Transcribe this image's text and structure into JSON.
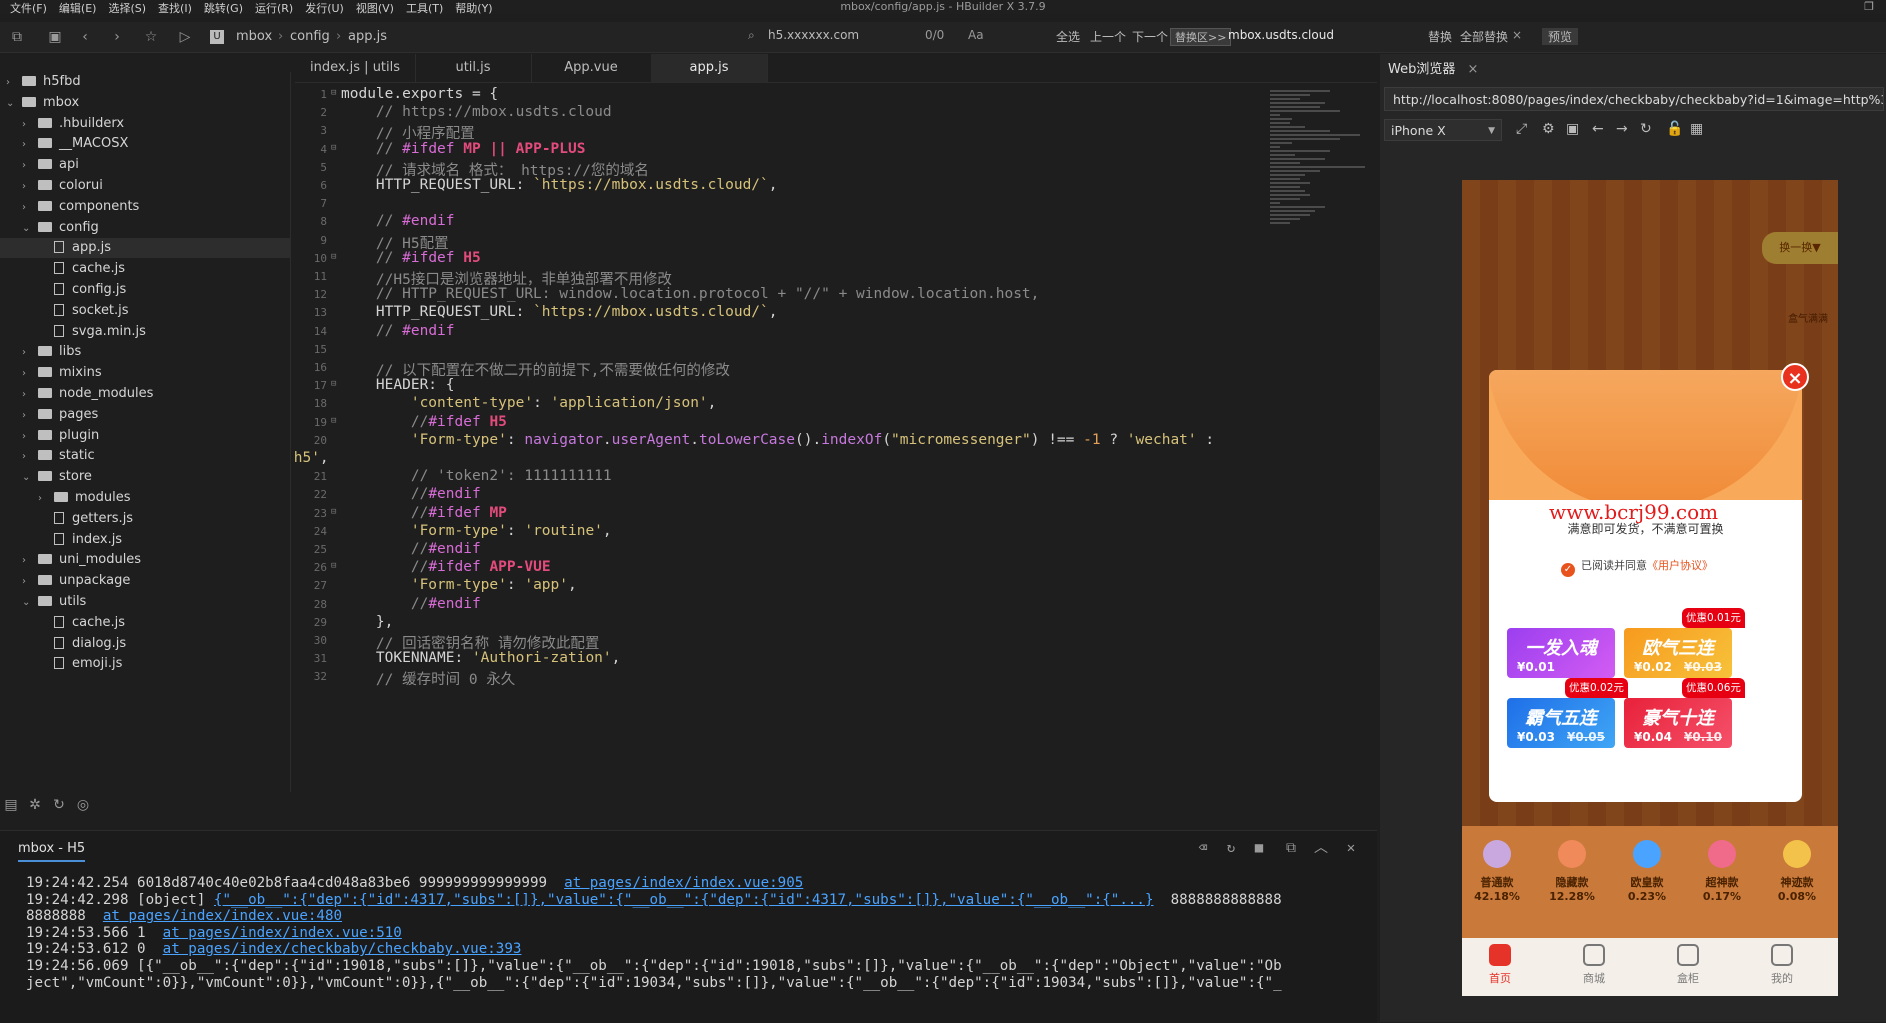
{
  "menubar": {
    "items": [
      "文件(F)",
      "编辑(E)",
      "选择(S)",
      "查找(I)",
      "跳转(G)",
      "运行(R)",
      "发行(U)",
      "视图(V)",
      "工具(T)",
      "帮助(Y)"
    ],
    "title": "mbox/config/app.js - HBuilder X 3.7.9"
  },
  "toolbar": {
    "breadcrumb": [
      "mbox",
      "config",
      "app.js"
    ],
    "find_value": "h5.xxxxxx.com",
    "find_count": "0/0",
    "case_label": "Aa",
    "select_all": "全选",
    "prev": "上一个",
    "next": "下一个",
    "replace_toggle": "替换区>>",
    "replace_value": "mbox.usdts.cloud",
    "replace": "替换",
    "replace_all": "全部替换",
    "preview": "预览"
  },
  "tree": [
    {
      "label": "h5fbd",
      "type": "folder",
      "level": 0,
      "open": false
    },
    {
      "label": "mbox",
      "type": "folder",
      "level": 0,
      "open": true
    },
    {
      "label": ".hbuilderx",
      "type": "folder",
      "level": 1,
      "open": false
    },
    {
      "label": "__MACOSX",
      "type": "folder",
      "level": 1,
      "open": false
    },
    {
      "label": "api",
      "type": "folder",
      "level": 1,
      "open": false
    },
    {
      "label": "colorui",
      "type": "folder",
      "level": 1,
      "open": false
    },
    {
      "label": "components",
      "type": "folder",
      "level": 1,
      "open": false
    },
    {
      "label": "config",
      "type": "folder",
      "level": 1,
      "open": true
    },
    {
      "label": "app.js",
      "type": "file",
      "level": 2,
      "selected": true
    },
    {
      "label": "cache.js",
      "type": "file",
      "level": 2
    },
    {
      "label": "config.js",
      "type": "file",
      "level": 2
    },
    {
      "label": "socket.js",
      "type": "file",
      "level": 2
    },
    {
      "label": "svga.min.js",
      "type": "file",
      "level": 2
    },
    {
      "label": "libs",
      "type": "folder",
      "level": 1,
      "open": false
    },
    {
      "label": "mixins",
      "type": "folder",
      "level": 1,
      "open": false
    },
    {
      "label": "node_modules",
      "type": "folder",
      "level": 1,
      "open": false
    },
    {
      "label": "pages",
      "type": "folder",
      "level": 1,
      "open": false
    },
    {
      "label": "plugin",
      "type": "folder",
      "level": 1,
      "open": false
    },
    {
      "label": "static",
      "type": "folder",
      "level": 1,
      "open": false
    },
    {
      "label": "store",
      "type": "folder",
      "level": 1,
      "open": true
    },
    {
      "label": "modules",
      "type": "folder",
      "level": 2,
      "open": false
    },
    {
      "label": "getters.js",
      "type": "file",
      "level": 2
    },
    {
      "label": "index.js",
      "type": "file",
      "level": 2
    },
    {
      "label": "uni_modules",
      "type": "folder",
      "level": 1,
      "open": false
    },
    {
      "label": "unpackage",
      "type": "folder",
      "level": 1,
      "open": false
    },
    {
      "label": "utils",
      "type": "folder",
      "level": 1,
      "open": true
    },
    {
      "label": "cache.js",
      "type": "file",
      "level": 2
    },
    {
      "label": "dialog.js",
      "type": "file",
      "level": 2
    },
    {
      "label": "emoji.js",
      "type": "file",
      "level": 2
    }
  ],
  "tabs": [
    {
      "label": "index.js | utils",
      "active": false
    },
    {
      "label": "util.js",
      "active": false
    },
    {
      "label": "App.vue",
      "active": false
    },
    {
      "label": "app.js",
      "active": true
    }
  ],
  "code": [
    {
      "n": 1,
      "fold": true,
      "html": "module.exports = {"
    },
    {
      "n": 2,
      "html": "    <span class='cmt'>// https://mbox.usdts.cloud</span>"
    },
    {
      "n": 3,
      "html": "    <span class='cmt'>// 小程序配置</span>"
    },
    {
      "n": 4,
      "fold": true,
      "html": "    <span class='cmt'>// </span><span class='kw'>#ifdef</span> <span class='kw2'>MP || APP-PLUS</span>"
    },
    {
      "n": 5,
      "html": "    <span class='cmt'>// 请求域名 格式： https://您的域名</span>"
    },
    {
      "n": 6,
      "html": "    HTTP_REQUEST_URL: <span class='str'>`https://mbox.usdts.cloud/`</span>,"
    },
    {
      "n": 7,
      "html": ""
    },
    {
      "n": 8,
      "html": "    <span class='cmt'>// </span><span class='kw'>#endif</span>"
    },
    {
      "n": 9,
      "html": "    <span class='cmt'>// H5配置</span>"
    },
    {
      "n": 10,
      "fold": true,
      "html": "    <span class='cmt'>// </span><span class='kw'>#ifdef</span> <span class='kw2'>H5</span>"
    },
    {
      "n": 11,
      "html": "    <span class='cmt'>//H5接口是浏览器地址，非单独部署不用修改</span>"
    },
    {
      "n": 12,
      "html": "    <span class='cmt'>// HTTP_REQUEST_URL: window.location.protocol + \"//\" + window.location.host,</span>"
    },
    {
      "n": 13,
      "html": "    HTTP_REQUEST_URL: <span class='str'>`https://mbox.usdts.cloud/`</span>,"
    },
    {
      "n": 14,
      "html": "    <span class='cmt'>// </span><span class='kw'>#endif</span>"
    },
    {
      "n": 15,
      "html": ""
    },
    {
      "n": 16,
      "html": "    <span class='cmt'>// 以下配置在不做二开的前提下,不需要做任何的修改</span>"
    },
    {
      "n": 17,
      "fold": true,
      "html": "    HEADER: {"
    },
    {
      "n": 18,
      "html": "        <span class='str'>'content-type'</span>: <span class='str'>'application/json'</span>,"
    },
    {
      "n": 19,
      "fold": true,
      "html": "        <span class='cmt'>//</span><span class='kw'>#ifdef</span> <span class='kw2'>H5</span>"
    },
    {
      "n": 20,
      "html": "        <span class='str'>'Form-type'</span>: <span class='fn'>navigator</span>.<span class='fn'>userAgent</span>.<span class='fn'>toLowerCase</span>().<span class='fn'>indexOf</span>(<span class='str'>\"micromessenger\"</span>) !== <span class='num'>-1</span> ? <span class='str'>'wechat'</span> :"
    },
    {
      "n": null,
      "html": "<span class='str'>'h5'</span>,"
    },
    {
      "n": 21,
      "html": "        <span class='cmt'>// 'token2': 1111111111</span>"
    },
    {
      "n": 22,
      "html": "        <span class='cmt'>//</span><span class='kw'>#endif</span>"
    },
    {
      "n": 23,
      "fold": true,
      "html": "        <span class='cmt'>//</span><span class='kw'>#ifdef</span> <span class='kw2'>MP</span>"
    },
    {
      "n": 24,
      "html": "        <span class='str'>'Form-type'</span>: <span class='str'>'routine'</span>,"
    },
    {
      "n": 25,
      "html": "        <span class='cmt'>//</span><span class='kw'>#endif</span>"
    },
    {
      "n": 26,
      "fold": true,
      "html": "        <span class='cmt'>//</span><span class='kw'>#ifdef</span> <span class='kw2'>APP-VUE</span>"
    },
    {
      "n": 27,
      "html": "        <span class='str'>'Form-type'</span>: <span class='str'>'app'</span>,"
    },
    {
      "n": 28,
      "html": "        <span class='cmt'>//</span><span class='kw'>#endif</span>"
    },
    {
      "n": 29,
      "html": "    },"
    },
    {
      "n": 30,
      "html": "    <span class='cmt'>// 回话密钥名称 请勿修改此配置</span>"
    },
    {
      "n": 31,
      "html": "    TOKENNAME: <span class='str'>'Authori-zation'</span>,"
    },
    {
      "n": 32,
      "html": "    <span class='cmt'>// 缓存时间 0 永久</span>"
    }
  ],
  "console": {
    "tab": "mbox - H5",
    "lines": [
      {
        "text": "19:24:42.254 6018d8740c40e02b8faa4cd048a83be6 999999999999999  ",
        "link": "at pages/index/index.vue:905",
        "tail": ""
      },
      {
        "text": "19:24:42.298 [object] ",
        "link": "{\"__ob__\":{\"dep\":{\"id\":4317,\"subs\":[]},\"value\":{\"__ob__\":{\"dep\":{\"id\":4317,\"subs\":[]},\"value\":{\"__ob__\":{\"...}",
        "tail": "  8888888888888"
      },
      {
        "text": "8888888  ",
        "link": "at pages/index/index.vue:480",
        "tail": ""
      },
      {
        "text": "19:24:53.566 1  ",
        "link": "at pages/index/index.vue:510",
        "tail": ""
      },
      {
        "text": "19:24:53.612 0  ",
        "link": "at pages/index/checkbaby/checkbaby.vue:393",
        "tail": ""
      },
      {
        "text": "19:24:56.069 [{\"__ob__\":{\"dep\":{\"id\":19018,\"subs\":[]},\"value\":{\"__ob__\":{\"dep\":{\"id\":19018,\"subs\":[]},\"value\":{\"__ob__\":{\"dep\":\"Object\",\"value\":\"Ob",
        "link": "",
        "tail": ""
      },
      {
        "text": "ject\",\"vmCount\":0}},\"vmCount\":0}},\"vmCount\":0}},{\"__ob__\":{\"dep\":{\"id\":19034,\"subs\":[]},\"value\":{\"__ob__\":{\"dep\":{\"id\":19034,\"subs\":[]},\"value\":{\"_",
        "link": "",
        "tail": ""
      }
    ]
  },
  "browser": {
    "tab": "Web浏览器",
    "url": "http://localhost:8080/pages/index/checkbaby/checkbaby?id=1&image=http%3A%2F%",
    "device": "iPhone X"
  },
  "phone": {
    "tag": "换一换▼",
    "side_text": "盒气满满",
    "stats": [
      {
        "label": "普通款",
        "value": "42.18%",
        "color": "#c9a8e0"
      },
      {
        "label": "隐藏款",
        "value": "12.28%",
        "color": "#f08a5a"
      },
      {
        "label": "欧皇款",
        "value": "0.23%",
        "color": "#4aa3ff"
      },
      {
        "label": "超神款",
        "value": "0.17%",
        "color": "#f06a8a"
      },
      {
        "label": "神迹款",
        "value": "0.08%",
        "color": "#f3c24a"
      }
    ],
    "nav": [
      {
        "label": "首页",
        "active": true
      },
      {
        "label": "商城",
        "active": false
      },
      {
        "label": "盒柜",
        "active": false
      },
      {
        "label": "我的",
        "active": false
      }
    ]
  },
  "modal": {
    "watermark": "www.bcrj99.com",
    "message": "满意即可发货，不满意可置换",
    "agree": "已阅读并同意",
    "agree_link": "《用户协议》",
    "cards": [
      {
        "name": "一发入魂",
        "price": "¥0.01",
        "old": "",
        "badge": "",
        "colors": [
          "#9b3ff0",
          "#d35cf2"
        ]
      },
      {
        "name": "欧气三连",
        "price": "¥0.02",
        "old": "¥0.03",
        "badge": "优惠0.01元",
        "colors": [
          "#f79a1e",
          "#f7c23a"
        ]
      },
      {
        "name": "霸气五连",
        "price": "¥0.03",
        "old": "¥0.05",
        "badge": "优惠0.02元",
        "colors": [
          "#1f6fe8",
          "#3fa6f5"
        ]
      },
      {
        "name": "豪气十连",
        "price": "¥0.04",
        "old": "¥0.10",
        "badge": "优惠0.06元",
        "colors": [
          "#e8213a",
          "#f5516a"
        ]
      }
    ],
    "close": "×"
  }
}
